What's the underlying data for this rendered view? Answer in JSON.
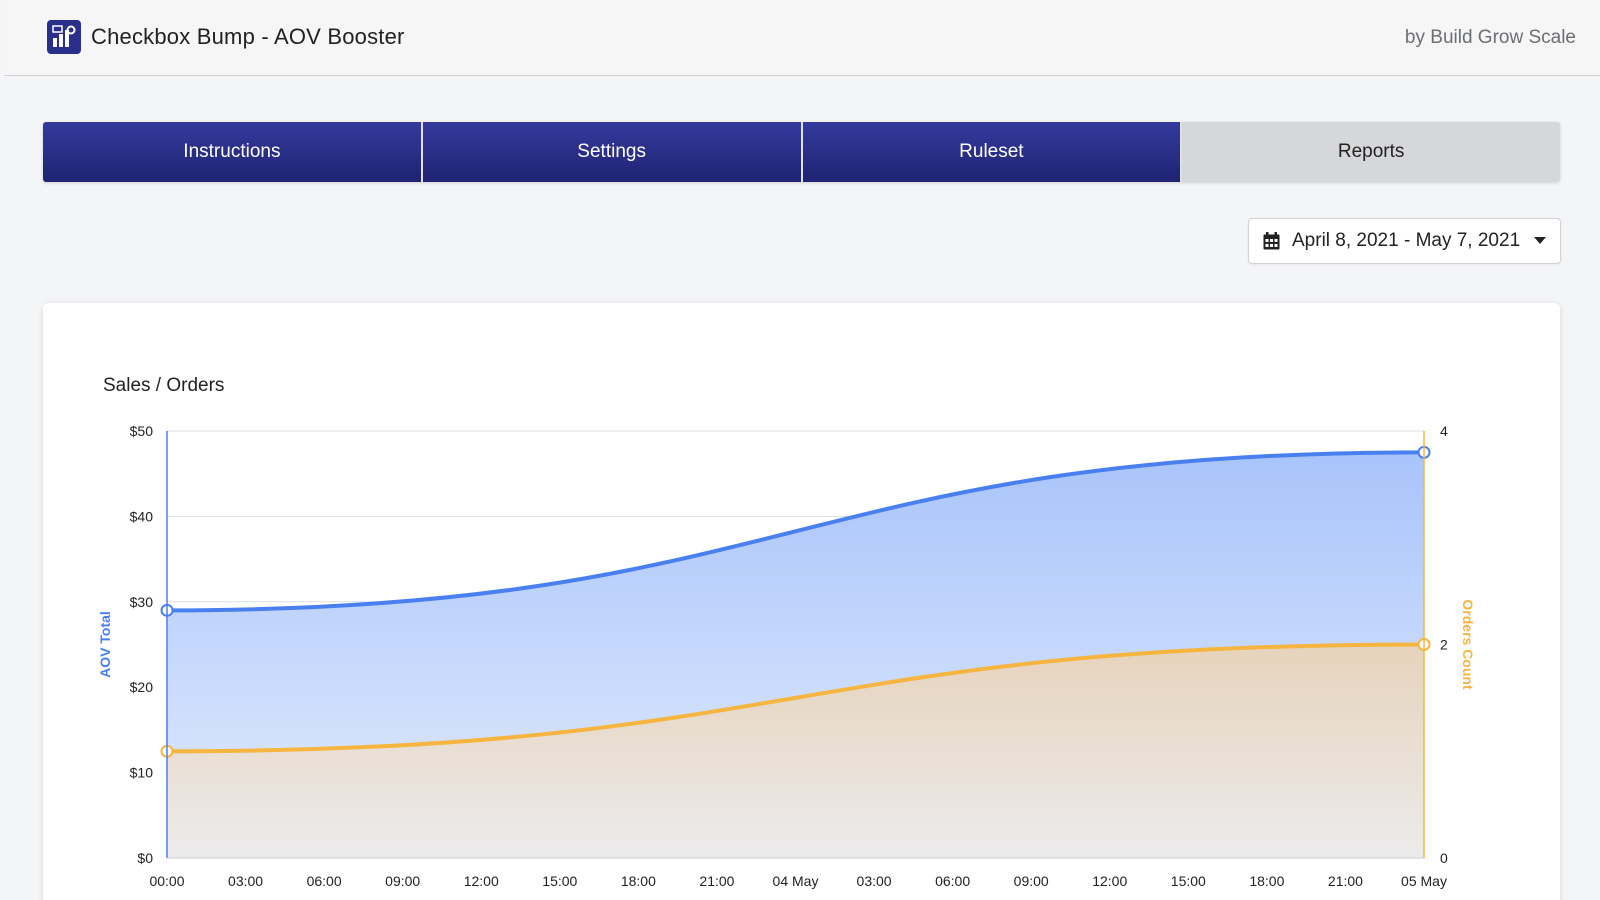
{
  "header": {
    "app_title": "Checkbox Bump - AOV Booster",
    "byline": "by Build Grow Scale",
    "app_icon": "app-logo-icon"
  },
  "tabs": [
    {
      "label": "Instructions",
      "active": false
    },
    {
      "label": "Settings",
      "active": false
    },
    {
      "label": "Ruleset",
      "active": false
    },
    {
      "label": "Reports",
      "active": true
    }
  ],
  "date_range": {
    "label": "April 8, 2021 - May 7, 2021",
    "icon": "calendar-icon",
    "caret_icon": "caret-down-icon"
  },
  "chart_data": {
    "type": "area",
    "title": "Sales / Orders",
    "x": [
      "00:00",
      "03:00",
      "06:00",
      "09:00",
      "12:00",
      "15:00",
      "18:00",
      "21:00",
      "04 May",
      "03:00",
      "06:00",
      "09:00",
      "12:00",
      "15:00",
      "18:00",
      "21:00",
      "05 May"
    ],
    "y_left": {
      "label": "AOV Total",
      "ticks": [
        "$0",
        "$10",
        "$20",
        "$30",
        "$40",
        "$50"
      ],
      "range": [
        0,
        50
      ],
      "color": "#4a7ff0"
    },
    "y_right": {
      "label": "Orders Count",
      "ticks": [
        "0",
        "2",
        "4"
      ],
      "range": [
        0,
        4
      ],
      "color": "#f5b53f"
    },
    "series": [
      {
        "name": "AOV Total",
        "axis": "left",
        "points": [
          [
            0,
            29
          ],
          [
            16,
            47.5
          ]
        ],
        "color": "#4a7ff0"
      },
      {
        "name": "Orders Count",
        "axis": "right",
        "points": [
          [
            0,
            1
          ],
          [
            16,
            2
          ]
        ],
        "color": "#f5b53f"
      }
    ],
    "grid": true
  }
}
